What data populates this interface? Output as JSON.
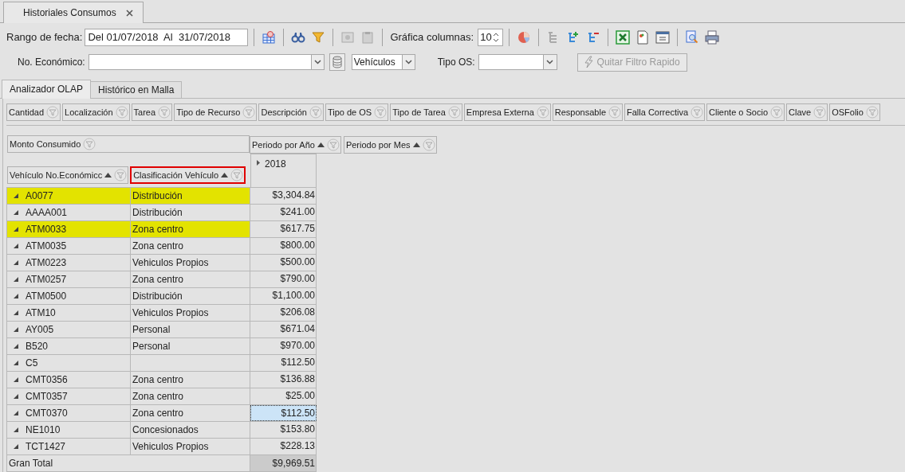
{
  "document_tab": {
    "title": "Historiales Consumos"
  },
  "toolbar": {
    "date_range": {
      "label": "Rango de fecha:",
      "value": "Del 01/07/2018  Al  31/07/2018"
    },
    "chart_columns": {
      "label": "Gráfica columnas:",
      "value": "10"
    }
  },
  "filters": {
    "economic_no": {
      "label": "No. Económico:"
    },
    "type_select": {
      "value": "Vehículos"
    },
    "os_type": {
      "label": "Tipo OS:"
    },
    "clear_button": {
      "label": "Quitar Filtro Rapido",
      "disabled": true
    }
  },
  "tabs": [
    {
      "label": "Analizador OLAP",
      "selected": true
    },
    {
      "label": "Histórico en Malla",
      "selected": false
    }
  ],
  "pivot": {
    "filter_fields": [
      "Cantidad",
      "Localización",
      "Tarea",
      "Tipo de Recurso",
      "Descripción",
      "Tipo de OS",
      "Tipo de Tarea",
      "Empresa Externa",
      "Responsable",
      "Falla Correctiva",
      "Cliente o Socio",
      "Clave",
      "OSFolio"
    ],
    "data_fields": [
      "Monto Consumido"
    ],
    "column_fields": [
      {
        "label": "Periodo por Año",
        "sorted": true
      },
      {
        "label": "Periodo por Mes",
        "sorted": true
      }
    ],
    "row_fields": [
      {
        "label": "Vehículo No.Económicc",
        "sorted": true,
        "outlined": false
      },
      {
        "label": "Clasificación Vehículo",
        "sorted": true,
        "outlined": true
      }
    ],
    "column_header": "2018",
    "rows": [
      {
        "vehicle": "A0077",
        "classification": "Distribución",
        "amount": "$3,304.84",
        "highlighted": true,
        "selected": false
      },
      {
        "vehicle": "AAAA001",
        "classification": "Distribución",
        "amount": "$241.00",
        "highlighted": false,
        "selected": false
      },
      {
        "vehicle": "ATM0033",
        "classification": "Zona centro",
        "amount": "$617.75",
        "highlighted": true,
        "selected": false
      },
      {
        "vehicle": "ATM0035",
        "classification": "Zona centro",
        "amount": "$800.00",
        "highlighted": false,
        "selected": false
      },
      {
        "vehicle": "ATM0223",
        "classification": "Vehiculos Propios",
        "amount": "$500.00",
        "highlighted": false,
        "selected": false
      },
      {
        "vehicle": "ATM0257",
        "classification": "Zona centro",
        "amount": "$790.00",
        "highlighted": false,
        "selected": false
      },
      {
        "vehicle": "ATM0500",
        "classification": "Distribución",
        "amount": "$1,100.00",
        "highlighted": false,
        "selected": false
      },
      {
        "vehicle": "ATM10",
        "classification": "Vehiculos Propios",
        "amount": "$206.08",
        "highlighted": false,
        "selected": false
      },
      {
        "vehicle": "AY005",
        "classification": "Personal",
        "amount": "$671.04",
        "highlighted": false,
        "selected": false
      },
      {
        "vehicle": "B520",
        "classification": "Personal",
        "amount": "$970.00",
        "highlighted": false,
        "selected": false
      },
      {
        "vehicle": "C5",
        "amount": "$112.50",
        "highlighted": false,
        "selected": false
      },
      {
        "vehicle": "CMT0356",
        "classification": "Zona centro",
        "amount": "$136.88",
        "highlighted": false,
        "selected": false
      },
      {
        "vehicle": "CMT0357",
        "classification": "Zona centro",
        "amount": "$25.00",
        "highlighted": false,
        "selected": false
      },
      {
        "vehicle": "CMT0370",
        "classification": "Zona centro",
        "amount": "$112.50",
        "highlighted": false,
        "selected": true
      },
      {
        "vehicle": "NE1010",
        "classification": "Concesionados",
        "amount": "$153.80",
        "highlighted": false,
        "selected": false
      },
      {
        "vehicle": "TCT1427",
        "classification": "Vehiculos Propios",
        "amount": "$228.13",
        "highlighted": false,
        "selected": false
      }
    ],
    "grand_total": {
      "label": "Gran Total",
      "amount": "$9,969.51"
    }
  }
}
